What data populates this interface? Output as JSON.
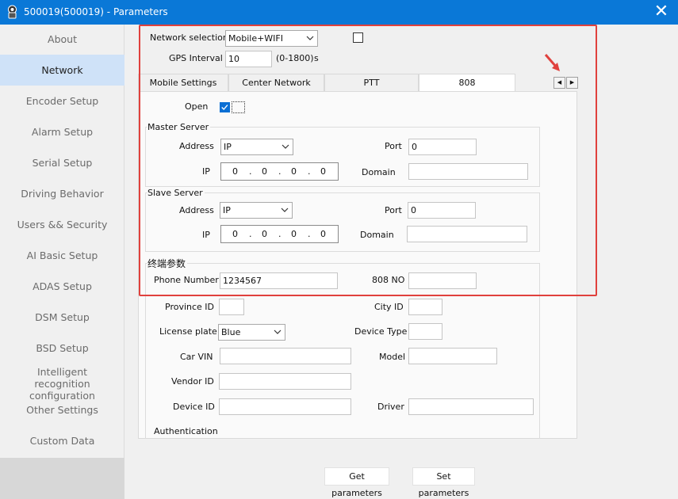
{
  "window": {
    "title": "500019(500019) - Parameters"
  },
  "sidebar": {
    "items": [
      {
        "label": "About"
      },
      {
        "label": "Network"
      },
      {
        "label": "Encoder Setup"
      },
      {
        "label": "Alarm Setup"
      },
      {
        "label": "Serial Setup"
      },
      {
        "label": "Driving Behavior"
      },
      {
        "label": "Users && Security"
      },
      {
        "label": "AI Basic Setup"
      },
      {
        "label": "ADAS Setup"
      },
      {
        "label": "DSM Setup"
      },
      {
        "label": "BSD Setup"
      },
      {
        "label": "Intelligent recognition configuration"
      },
      {
        "label": "Other Settings"
      },
      {
        "label": "Custom Data"
      }
    ],
    "active_index": 1
  },
  "network": {
    "selection_label": "Network selection",
    "selection_value": "Mobile+WIFI",
    "gps_label": "GPS Interval",
    "gps_value": "10",
    "gps_range": "(0-1800)",
    "gps_unit": "s"
  },
  "tabs": [
    {
      "label": "Mobile Settings"
    },
    {
      "label": "Center Network"
    },
    {
      "label": "PTT"
    },
    {
      "label": "808"
    }
  ],
  "active_tab": 3,
  "form808": {
    "open_label": "Open",
    "master": {
      "title": "Master Server",
      "address_label": "Address",
      "address_value": "IP",
      "ip_label": "IP",
      "ip_octets": [
        "0",
        "0",
        "0",
        "0"
      ],
      "port_label": "Port",
      "port_value": "0",
      "domain_label": "Domain",
      "domain_value": ""
    },
    "slave": {
      "title": "Slave Server",
      "address_label": "Address",
      "address_value": "IP",
      "ip_label": "IP",
      "ip_octets": [
        "0",
        "0",
        "0",
        "0"
      ],
      "port_label": "Port",
      "port_value": "0",
      "domain_label": "Domain",
      "domain_value": ""
    },
    "terminal": {
      "title": "终端参数",
      "phone_label": "Phone Number",
      "phone_value": "1234567",
      "no808_label": "808 NO",
      "no808_value": "",
      "province_label": "Province ID",
      "province_value": "",
      "city_label": "City ID",
      "city_value": "",
      "plate_label": "License plate",
      "plate_value": "Blue",
      "device_type_label": "Device Type",
      "device_type_value": "",
      "vin_label": "Car VIN",
      "vin_value": "",
      "model_label": "Model",
      "model_value": "",
      "vendor_label": "Vendor ID",
      "vendor_value": "",
      "device_id_label": "Device ID",
      "device_id_value": "",
      "driver_label": "Driver",
      "driver_value": "",
      "auth_label": "Authentication"
    }
  },
  "buttons": {
    "get": "Get parameters",
    "set": "Set parameters"
  },
  "colors": {
    "titlebar": "#0a78d7",
    "highlight_box": "#e0413d",
    "sidebar_active": "#cfe2f8",
    "checkbox_checked": "#0a6fd4"
  }
}
